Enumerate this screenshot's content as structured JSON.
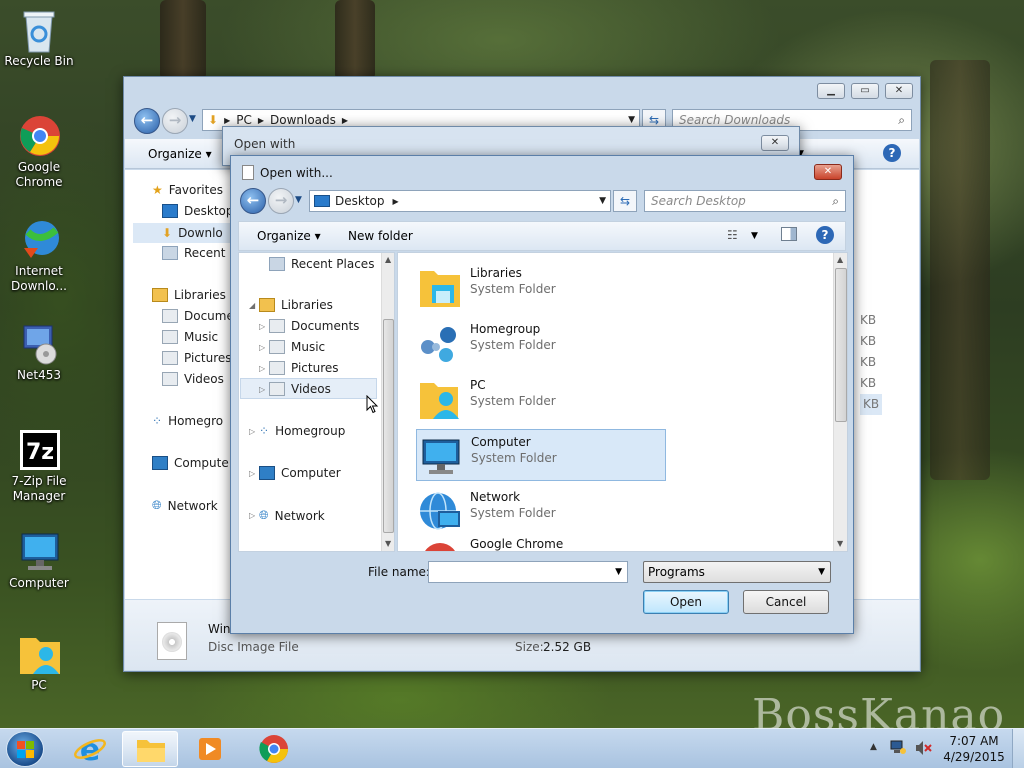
{
  "desktop": {
    "icons": [
      {
        "label": "Recycle Bin"
      },
      {
        "label": "Google Chrome"
      },
      {
        "label": "Internet Downlo..."
      },
      {
        "label": "Net453"
      },
      {
        "label": "7-Zip File Manager"
      },
      {
        "label": "Computer"
      },
      {
        "label": "PC"
      }
    ],
    "watermark": "BossKanao"
  },
  "explorer": {
    "address": [
      "PC",
      "Downloads"
    ],
    "search_placeholder": "Search Downloads",
    "organize_label": "Organize",
    "nav": {
      "favorites": "Favorites",
      "desktop": "Desktop",
      "downloads": "Downlo",
      "recent": "Recent",
      "libraries": "Libraries",
      "documents": "Docume",
      "music": "Music",
      "pictures": "Pictures",
      "videos": "Videos",
      "homegroup": "Homegro",
      "computer": "Compute",
      "network": "Network"
    },
    "size_column": [
      "KB",
      "KB",
      "KB",
      "KB",
      "KB"
    ],
    "details": {
      "name": "Win",
      "type": "Disc Image File",
      "size_label": "Size:",
      "size_value": "2.52 GB"
    }
  },
  "open_with_back": {
    "title": "Open with"
  },
  "dialog": {
    "title": "Open with...",
    "address": [
      "Desktop"
    ],
    "search_placeholder": "Search Desktop",
    "organize_label": "Organize",
    "new_folder_label": "New folder",
    "tree": {
      "recent_places": "Recent Places",
      "libraries": "Libraries",
      "documents": "Documents",
      "music": "Music",
      "pictures": "Pictures",
      "videos": "Videos",
      "homegroup": "Homegroup",
      "computer": "Computer",
      "network": "Network"
    },
    "files": [
      {
        "name": "Libraries",
        "type": "System Folder"
      },
      {
        "name": "Homegroup",
        "type": "System Folder"
      },
      {
        "name": "PC",
        "type": "System Folder"
      },
      {
        "name": "Computer",
        "type": "System Folder"
      },
      {
        "name": "Network",
        "type": "System Folder"
      },
      {
        "name": "Google Chrome",
        "type": ""
      }
    ],
    "filename_label": "File name:",
    "filename_value": "",
    "filter_value": "Programs",
    "open_label": "Open",
    "cancel_label": "Cancel"
  },
  "taskbar": {
    "time": "7:07 AM",
    "date": "4/29/2015"
  }
}
